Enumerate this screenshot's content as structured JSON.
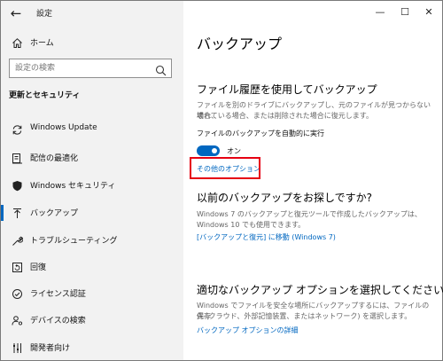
{
  "window": {
    "title": "設定",
    "minimize": "—",
    "maximize": "☐",
    "close": "✕"
  },
  "sidebar": {
    "home": "ホーム",
    "search_placeholder": "設定の検索",
    "section_title": "更新とセキュリティ",
    "items": [
      {
        "label": "Windows Update",
        "icon": "sync-icon"
      },
      {
        "label": "配信の最適化",
        "icon": "delivery-optimization-icon"
      },
      {
        "label": "Windows セキュリティ",
        "icon": "shield-icon"
      },
      {
        "label": "バックアップ",
        "icon": "backup-arrow-icon",
        "selected": true
      },
      {
        "label": "トラブルシューティング",
        "icon": "wrench-icon"
      },
      {
        "label": "回復",
        "icon": "recovery-icon"
      },
      {
        "label": "ライセンス認証",
        "icon": "check-circle-icon"
      },
      {
        "label": "デバイスの検索",
        "icon": "person-location-icon"
      },
      {
        "label": "開発者向け",
        "icon": "developer-icon"
      }
    ]
  },
  "main": {
    "title": "バックアップ",
    "file_history": {
      "heading": "ファイル履歴を使用してバックアップ",
      "desc1": "ファイルを別のドライブにバックアップし、元のファイルが見つからない場合、",
      "desc2": "壊れている場合、または削除された場合に復元します。",
      "auto_label": "ファイルのバックアップを自動的に実行",
      "toggle_state": "オン",
      "more_options": "その他のオプション"
    },
    "older_backup": {
      "heading": "以前のバックアップをお探しですか?",
      "desc1": "Windows 7 のバックアップと復元ツールで作成したバックアップは、",
      "desc2": "Windows 10 でも使用できます。",
      "link": "[バックアップと復元] に移動 (Windows 7)"
    },
    "right_option": {
      "heading": "適切なバックアップ オプションを選択してください",
      "desc1": "Windows でファイルを安全な場所にバックアップするには、ファイルの保存",
      "desc2": "先 (クラウド、外部記憶装置、またはネットワーク) を選択します。",
      "link": "バックアップ オプションの詳細"
    }
  },
  "colors": {
    "accent": "#0067c0",
    "highlight": "#e60012",
    "sidebar_bg": "#f2f2f2"
  }
}
